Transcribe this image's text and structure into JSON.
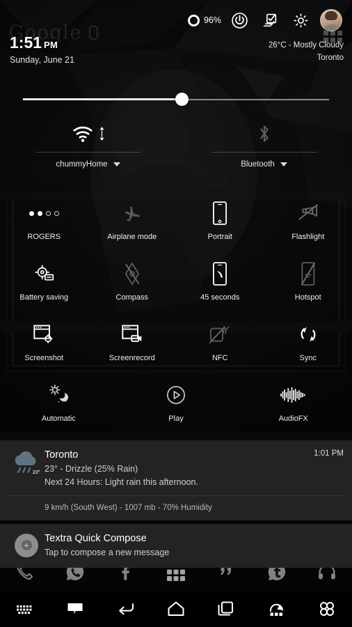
{
  "status_bar": {
    "battery_percent": "96%",
    "icons": [
      "battery-ring-icon",
      "power-icon",
      "tasks-check-icon",
      "gear-icon",
      "avatar"
    ]
  },
  "header": {
    "search_widget_ghost": "Google",
    "time": "1:51",
    "meridiem": "PM",
    "date": "Sunday, June 21",
    "weather_condition": "26°C - Mostly Cloudy",
    "weather_location": "Toronto"
  },
  "brightness": {
    "label": "brightness-slider",
    "value_percent": 52
  },
  "connectivity": [
    {
      "icon": "wifi-icon",
      "label": "chummyHome",
      "state": "on",
      "has_caret": true,
      "sub_icon": "data-transfer-arrows-icon"
    },
    {
      "icon": "bluetooth-icon",
      "label": "Bluetooth",
      "state": "off",
      "has_caret": true,
      "sub_icon": ""
    }
  ],
  "tiles": [
    [
      {
        "label": "ROGERS",
        "icon": "signal-dots-icon",
        "state": "on",
        "signal_on": 2,
        "signal_total": 4
      },
      {
        "label": "Airplane mode",
        "icon": "airplane-icon",
        "state": "off"
      },
      {
        "label": "Portrait",
        "icon": "phone-portrait-icon",
        "state": "on"
      },
      {
        "label": "Flashlight",
        "icon": "flashlight-off-icon",
        "state": "off"
      }
    ],
    [
      {
        "label": "Battery saving",
        "icon": "battery-saver-icon",
        "state": "on"
      },
      {
        "label": "Compass",
        "icon": "compass-off-icon",
        "state": "off"
      },
      {
        "label": "45 seconds",
        "icon": "screen-timeout-icon",
        "state": "on"
      },
      {
        "label": "Hotspot",
        "icon": "hotspot-off-icon",
        "state": "off"
      }
    ],
    [
      {
        "label": "Screenshot",
        "icon": "screenshot-icon",
        "state": "on"
      },
      {
        "label": "Screenrecord",
        "icon": "screenrecord-icon",
        "state": "on"
      },
      {
        "label": "NFC",
        "icon": "nfc-off-icon",
        "state": "off"
      },
      {
        "label": "Sync",
        "icon": "sync-icon",
        "state": "on"
      }
    ],
    [
      {
        "label": "Automatic",
        "icon": "auto-brightness-icon",
        "state": "on"
      },
      {
        "label": "Play",
        "icon": "play-circle-icon",
        "state": "on"
      },
      {
        "label": "AudioFX",
        "icon": "equalizer-icon",
        "state": "on"
      }
    ]
  ],
  "notifications": [
    {
      "app": "weather",
      "icon": "rain-cloud-icon",
      "icon_badge": "23°",
      "title": "Toronto",
      "line1": "23° - Drizzle (25% Rain)",
      "line2": "Next 24 Hours: Light rain this afternoon.",
      "time": "1:01 PM",
      "sub": "9 km/h (South West) - 1007 mb - 70% Humidity"
    },
    {
      "app": "textra",
      "icon": "plus-circle-avatar-icon",
      "icon_badge": "+",
      "title": "Textra Quick Compose",
      "line1": "Tap to compose a new message",
      "line2": "",
      "time": "",
      "sub": ""
    }
  ],
  "dock": [
    "phone-icon",
    "whatsapp-icon",
    "facebook-icon",
    "app-drawer-icon",
    "hangouts-icon",
    "tumblr-icon",
    "headphones-icon"
  ],
  "navbar": [
    "keyboard-icon",
    "notification-icon",
    "back-icon",
    "home-icon",
    "recents-icon",
    "menu-rotate-icon",
    "quad-circles-icon"
  ],
  "colors": {
    "background": "#050505",
    "notification_card": "#232323",
    "accent_white": "#ffffff",
    "weather_icon": "#5f7380",
    "dim_icon": "#6a6a6a"
  }
}
